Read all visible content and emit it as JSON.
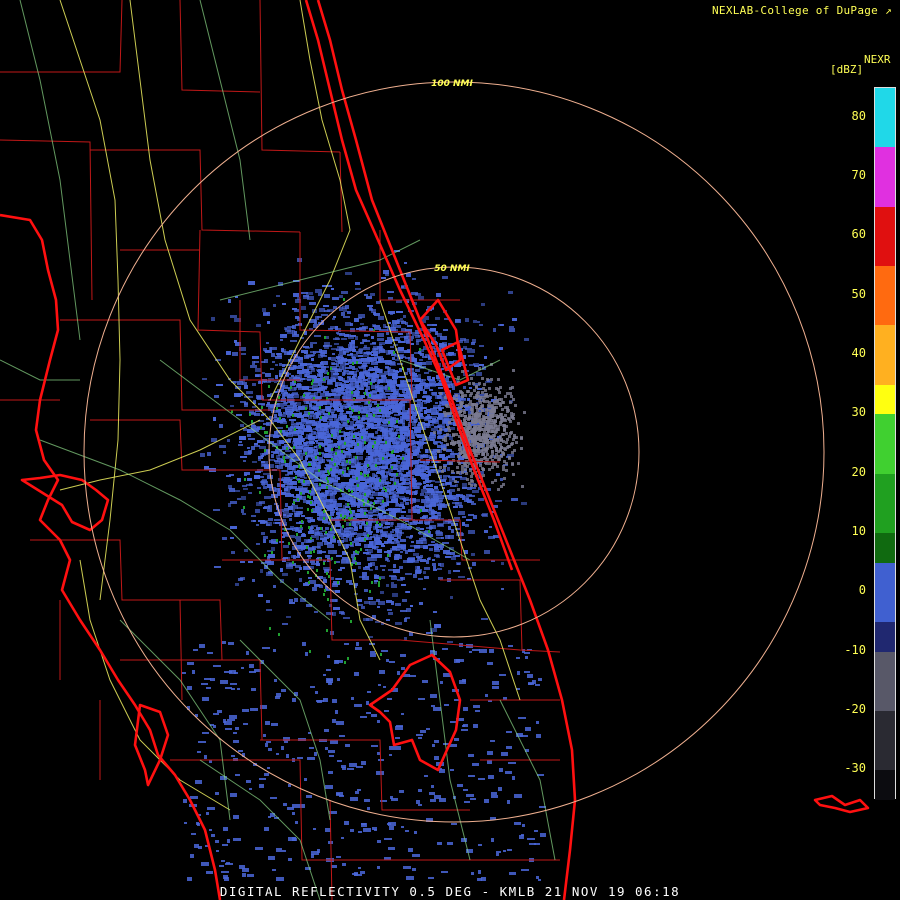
{
  "credit": "NEXLAB-College of DuPage",
  "credit_icon": "external-link-icon",
  "product_code": "NEXR",
  "unit": "[dBZ]",
  "caption": "DIGITAL REFLECTIVITY 0.5 DEG - KMLB 21 NOV 19 06:18",
  "range_rings": [
    {
      "label": "100 NMI",
      "nmi": 100
    },
    {
      "label": "50 NMI",
      "nmi": 50
    }
  ],
  "color_scale": {
    "min": -35,
    "max": 85,
    "ticks": [
      "80",
      "70",
      "60",
      "50",
      "40",
      "30",
      "20",
      "10",
      "0",
      "-10",
      "-20",
      "-30"
    ],
    "tick_values": [
      80,
      70,
      60,
      50,
      40,
      30,
      20,
      10,
      0,
      -10,
      -20,
      -30
    ],
    "bands": [
      {
        "from": 75,
        "to": 85,
        "color": "#20d8e8"
      },
      {
        "from": 65,
        "to": 75,
        "color": "#e030e0"
      },
      {
        "from": 55,
        "to": 65,
        "color": "#e01010"
      },
      {
        "from": 45,
        "to": 55,
        "color": "#ff6a10"
      },
      {
        "from": 35,
        "to": 45,
        "color": "#ffb020"
      },
      {
        "from": 30,
        "to": 35,
        "color": "#ffff10"
      },
      {
        "from": 20,
        "to": 30,
        "color": "#40d030"
      },
      {
        "from": 10,
        "to": 20,
        "color": "#20a020"
      },
      {
        "from": 5,
        "to": 10,
        "color": "#106a10"
      },
      {
        "from": -5,
        "to": 5,
        "color": "#4060d0"
      },
      {
        "from": -10,
        "to": -5,
        "color": "#202870"
      },
      {
        "from": -20,
        "to": -10,
        "color": "#585868"
      },
      {
        "from": -30,
        "to": -20,
        "color": "#2a2a32"
      },
      {
        "from": -35,
        "to": -30,
        "color": "#0c0c10"
      }
    ]
  },
  "colors": {
    "coastline": "#ff1010",
    "county_lines": "#c01818",
    "highways": "#f0f060",
    "roads": "#8cd888",
    "range_ring": "#f0b090",
    "echo_weak": "#4a66d8",
    "echo_clutter": "#7a7a90",
    "echo_light": "#20a030"
  }
}
